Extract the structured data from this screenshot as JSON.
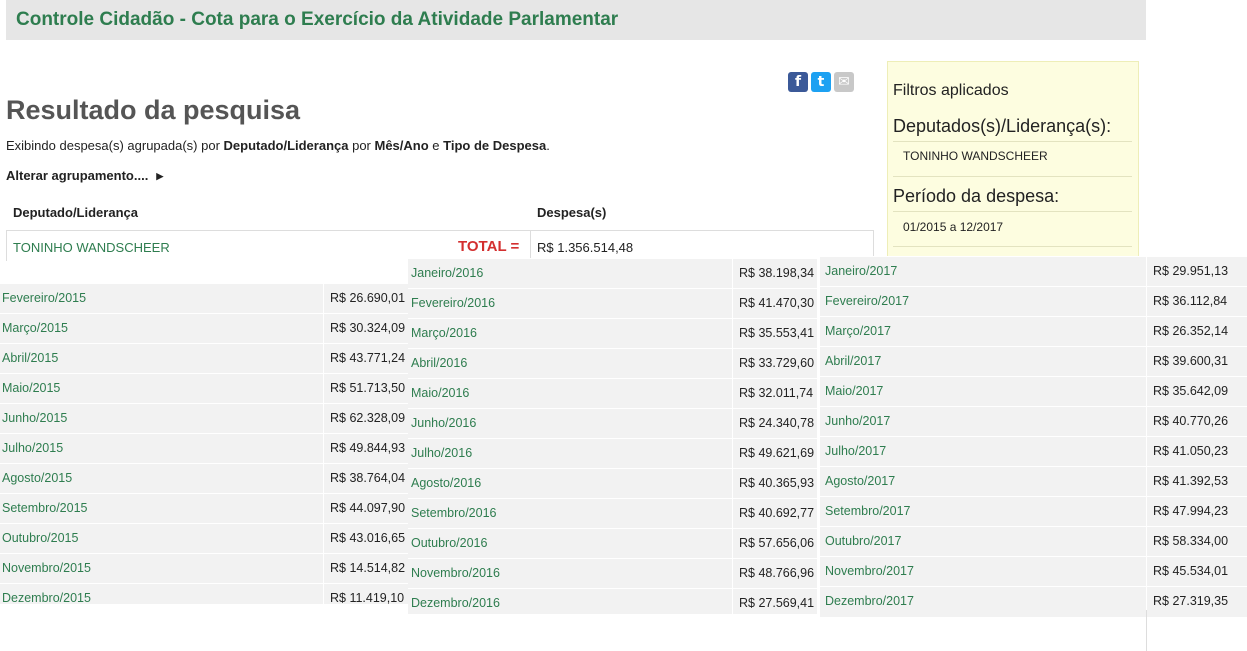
{
  "header": {
    "title": "Controle Cidadão - Cota para o Exercício da Atividade Parlamentar"
  },
  "share": {
    "facebook_glyph": "f",
    "twitter_glyph": "t",
    "email_glyph": "✉"
  },
  "results": {
    "heading": "Resultado da pesquisa",
    "summary_prefix": "Exibindo despesa(s) agrupada(s) por ",
    "group1": "Deputado/Liderança",
    "conj1": " por ",
    "group2": "Mês/Ano",
    "conj2": " e ",
    "group3": "Tipo de Despesa",
    "summary_end": ".",
    "regroup_label": "Alterar agrupamento....",
    "table": {
      "col_deputy": "Deputado/Liderança",
      "col_expense": "Despesa(s)",
      "deputy": "TONINHO WANDSCHEER",
      "total_label": "TOTAL =",
      "total_value": "R$ 1.356.514,48"
    }
  },
  "filters": {
    "title": "Filtros aplicados",
    "deputies_label": "Deputados(s)/Liderança(s):",
    "deputies_value": "TONINHO WANDSCHEER",
    "period_label": "Período da despesa:",
    "period_value": "01/2015 a 12/2017"
  },
  "columns": [
    {
      "rows": [
        {
          "month": "Fevereiro/2015",
          "value": "R$ 26.690,01"
        },
        {
          "month": "Março/2015",
          "value": "R$ 30.324,09"
        },
        {
          "month": "Abril/2015",
          "value": "R$ 43.771,24"
        },
        {
          "month": "Maio/2015",
          "value": "R$ 51.713,50"
        },
        {
          "month": "Junho/2015",
          "value": "R$ 62.328,09"
        },
        {
          "month": "Julho/2015",
          "value": "R$ 49.844,93"
        },
        {
          "month": "Agosto/2015",
          "value": "R$ 38.764,04"
        },
        {
          "month": "Setembro/2015",
          "value": "R$ 44.097,90"
        },
        {
          "month": "Outubro/2015",
          "value": "R$ 43.016,65"
        },
        {
          "month": "Novembro/2015",
          "value": "R$ 14.514,82"
        },
        {
          "month": "Dezembro/2015",
          "value": "R$ 11.419,10"
        }
      ]
    },
    {
      "rows": [
        {
          "month": "Janeiro/2016",
          "value": "R$ 38.198,34"
        },
        {
          "month": "Fevereiro/2016",
          "value": "R$ 41.470,30"
        },
        {
          "month": "Março/2016",
          "value": "R$ 35.553,41"
        },
        {
          "month": "Abril/2016",
          "value": "R$ 33.729,60"
        },
        {
          "month": "Maio/2016",
          "value": "R$ 32.011,74"
        },
        {
          "month": "Junho/2016",
          "value": "R$ 24.340,78"
        },
        {
          "month": "Julho/2016",
          "value": "R$ 49.621,69"
        },
        {
          "month": "Agosto/2016",
          "value": "R$ 40.365,93"
        },
        {
          "month": "Setembro/2016",
          "value": "R$ 40.692,77"
        },
        {
          "month": "Outubro/2016",
          "value": "R$ 57.656,06"
        },
        {
          "month": "Novembro/2016",
          "value": "R$ 48.766,96"
        },
        {
          "month": "Dezembro/2016",
          "value": "R$ 27.569,41"
        }
      ]
    },
    {
      "rows": [
        {
          "month": "Janeiro/2017",
          "value": "R$ 29.951,13"
        },
        {
          "month": "Fevereiro/2017",
          "value": "R$ 36.112,84"
        },
        {
          "month": "Março/2017",
          "value": "R$ 26.352,14"
        },
        {
          "month": "Abril/2017",
          "value": "R$ 39.600,31"
        },
        {
          "month": "Maio/2017",
          "value": "R$ 35.642,09"
        },
        {
          "month": "Junho/2017",
          "value": "R$ 40.770,26"
        },
        {
          "month": "Julho/2017",
          "value": "R$ 41.050,23"
        },
        {
          "month": "Agosto/2017",
          "value": "R$ 41.392,53"
        },
        {
          "month": "Setembro/2017",
          "value": "R$ 47.994,23"
        },
        {
          "month": "Outubro/2017",
          "value": "R$ 58.334,00"
        },
        {
          "month": "Novembro/2017",
          "value": "R$ 45.534,01"
        },
        {
          "month": "Dezembro/2017",
          "value": "R$ 27.319,35"
        }
      ]
    }
  ],
  "colors": {
    "accent_green": "#2e7d4f",
    "total_red": "#d32f2f",
    "facebook": "#3b5998",
    "twitter": "#1da1f2",
    "email": "#c8c8c8"
  }
}
